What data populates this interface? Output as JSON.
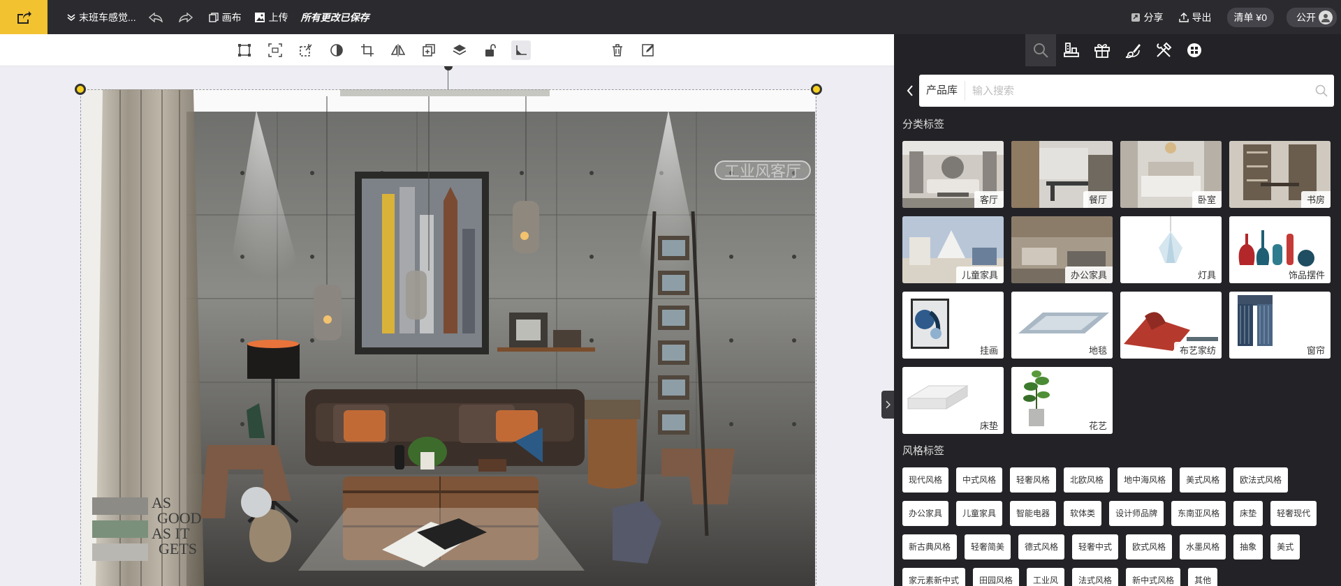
{
  "topbar": {
    "title": "末班车感觉...",
    "canvas_label": "画布",
    "upload_label": "上传",
    "save_status": "所有更改已保存",
    "share_label": "分享",
    "export_label": "导出",
    "cart_label": "清单 ¥0",
    "visibility_label": "公开"
  },
  "canvas": {
    "watermark": "工业风客厅",
    "poster_text": "AS GOOD AS IT GETS"
  },
  "panel": {
    "library_label": "产品库",
    "search_placeholder": "输入搜索",
    "category_title": "分类标签",
    "categories": [
      "客厅",
      "餐厅",
      "卧室",
      "书房",
      "儿童家具",
      "办公家具",
      "灯具",
      "饰品摆件",
      "挂画",
      "地毯",
      "布艺家纺",
      "窗帘",
      "床垫",
      "花艺"
    ],
    "style_title": "风格标签",
    "styles": [
      "现代风格",
      "中式风格",
      "轻奢风格",
      "北欧风格",
      "地中海风格",
      "美式风格",
      "欧法式风格",
      "办公家具",
      "儿童家具",
      "智能电器",
      "软体类",
      "设计师品牌",
      "东南亚风格",
      "床垫",
      "轻奢现代",
      "新古典风格",
      "轻奢简美",
      "德式风格",
      "轻奢中式",
      "欧式风格",
      "水墨风格",
      "抽象",
      "美式",
      "家元素新中式",
      "田园风格",
      "工业风",
      "法式风格",
      "新中式风格",
      "其他"
    ]
  },
  "colors": {
    "accent": "#f2c230",
    "topbar_bg": "#2b2b2f",
    "panel_bg": "#232327"
  }
}
